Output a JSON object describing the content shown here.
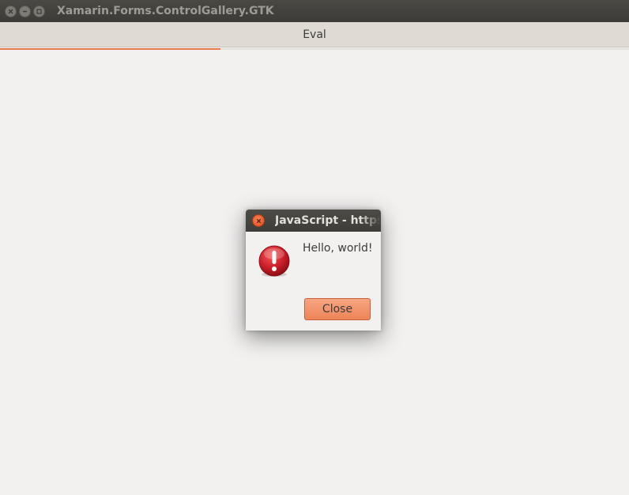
{
  "window": {
    "title": "Xamarin.Forms.ControlGallery.GTK",
    "buttons": [
      "close-icon",
      "minimize-icon",
      "maximize-icon"
    ]
  },
  "header": {
    "title": "Eval"
  },
  "progress": {
    "value": 0.35,
    "color": "#e9794a"
  },
  "dialog": {
    "title": "JavaScript - https",
    "icon": "error-icon",
    "message": "Hello, world!",
    "close_label": "Close",
    "close_icon": "close-icon"
  },
  "colors": {
    "accent": "#ee8457",
    "titlebar": "#3c3b37",
    "background": "#f2f1f0"
  }
}
